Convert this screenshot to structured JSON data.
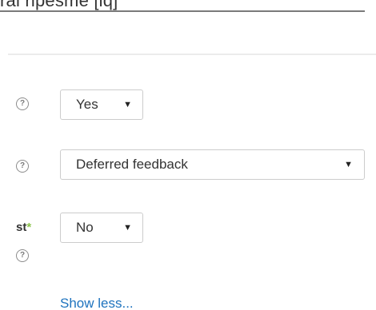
{
  "top_field": {
    "value": "rai ripesme [iq]"
  },
  "rows": [
    {
      "help_icon": "?",
      "select_value": "Yes",
      "caret": "▼"
    },
    {
      "help_icon": "?",
      "select_value": "Deferred feedback",
      "caret": "▼"
    },
    {
      "label_text": "st",
      "required_star": "*",
      "help_icon": "?",
      "select_value": "No",
      "caret": "▼"
    }
  ],
  "show_less_link": "Show less...",
  "colors": {
    "link": "#1e73be",
    "required_star": "#8bc34a",
    "select_border": "#cccccc",
    "text": "#333333"
  }
}
